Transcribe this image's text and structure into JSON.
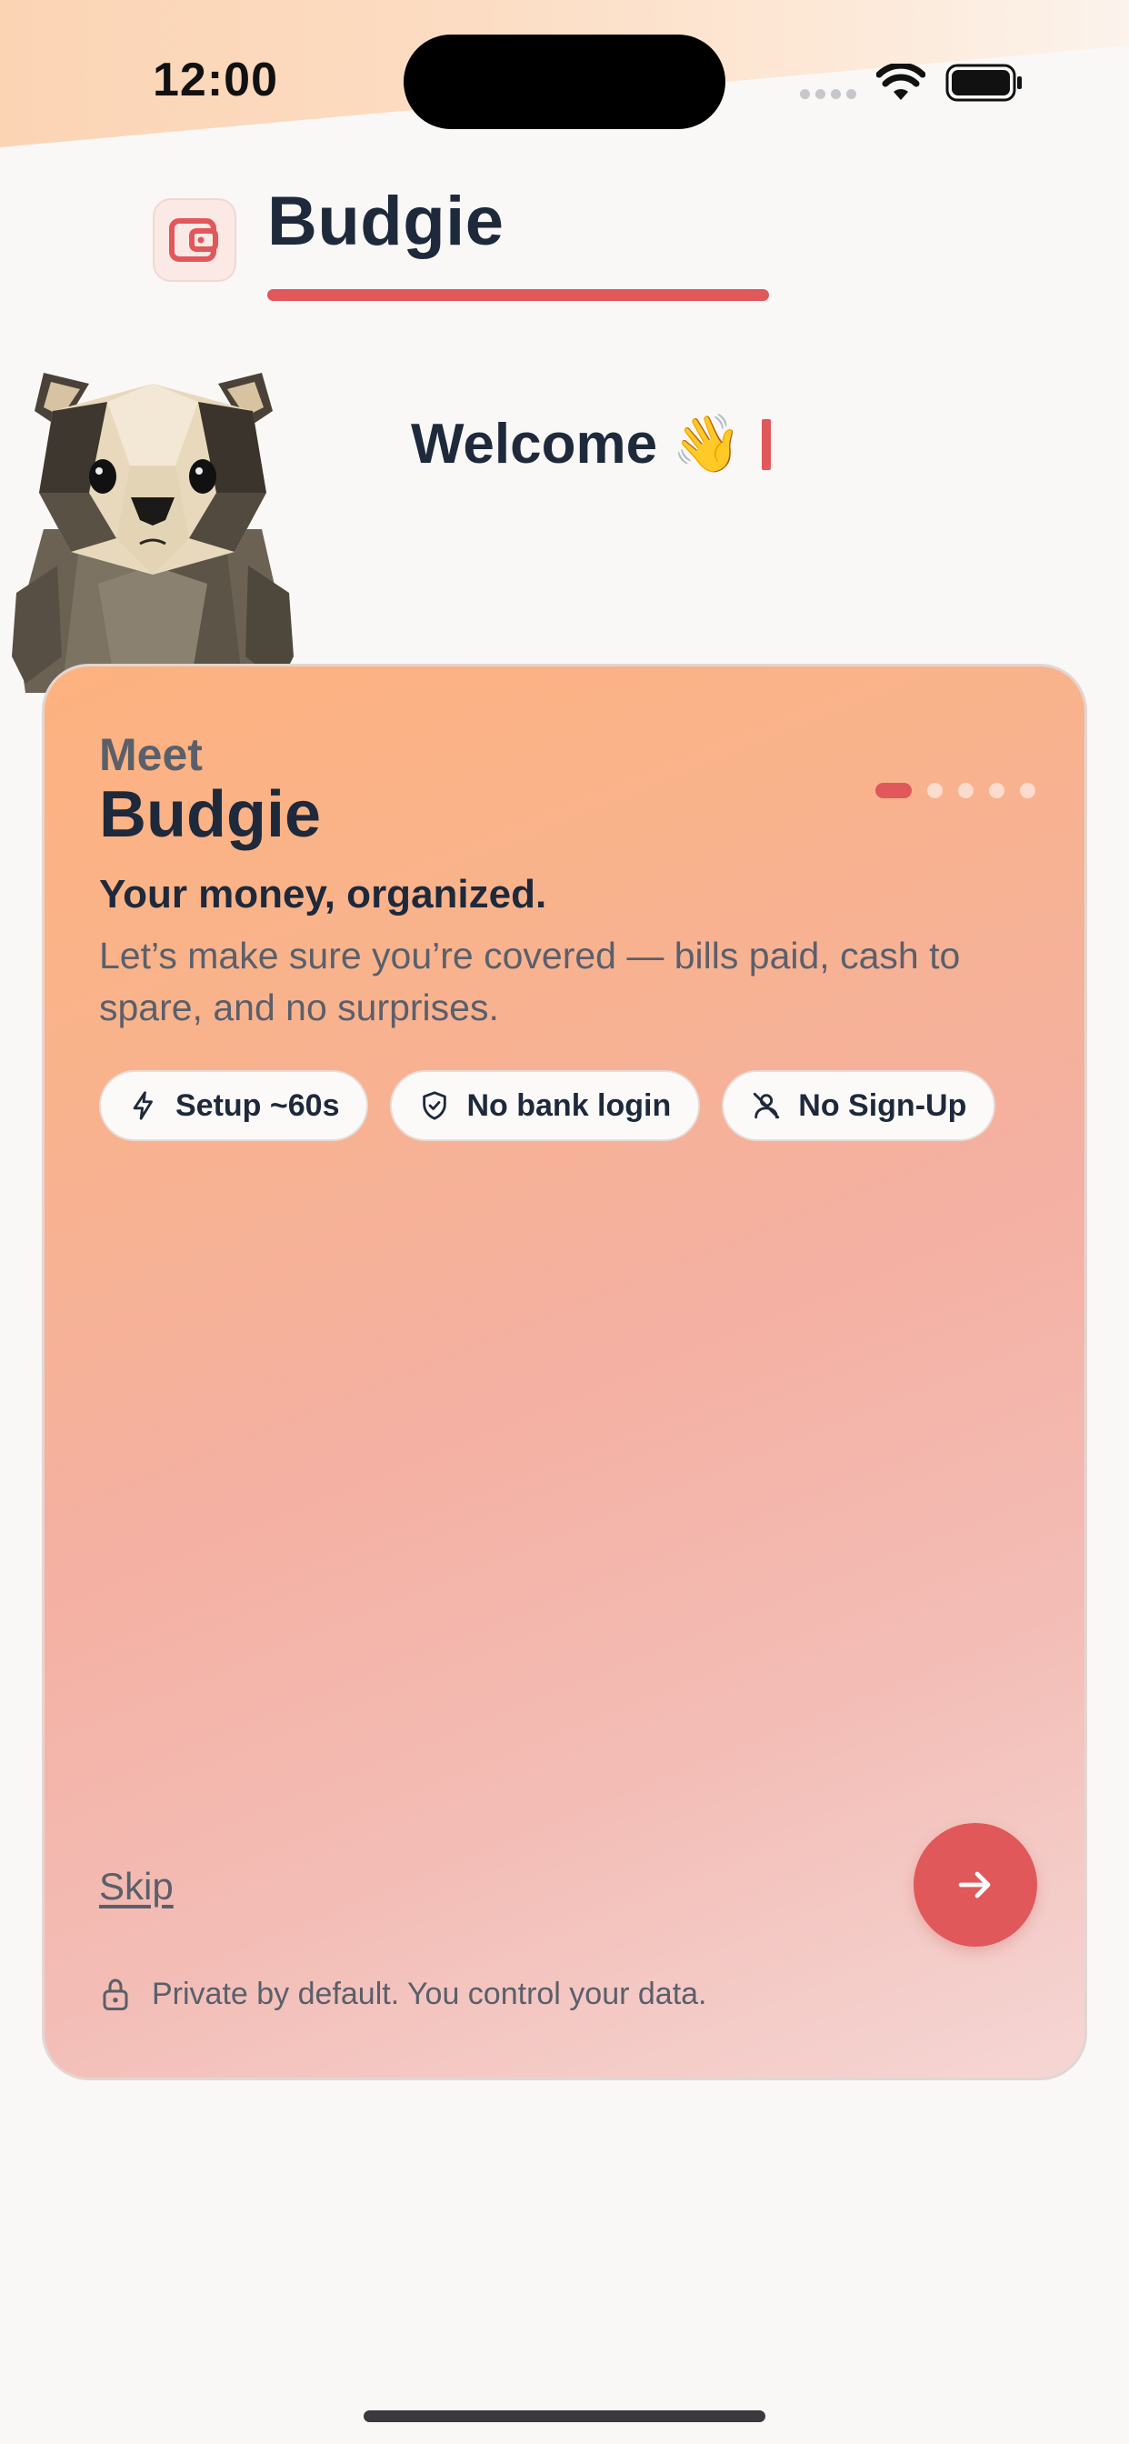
{
  "status_bar": {
    "time": "12:00"
  },
  "header": {
    "app_name": "Budgie",
    "logo_icon": "wallet-icon"
  },
  "welcome": {
    "text": "Welcome",
    "emoji": "👋"
  },
  "card": {
    "eyebrow": "Meet",
    "title": "Budgie",
    "tagline": "Your money, organized.",
    "description": "Let’s make sure you’re covered — bills paid, cash to spare, and no surprises.",
    "pager": {
      "total": 5,
      "current": 1
    },
    "chips": [
      {
        "icon": "bolt-icon",
        "label": "Setup ~60s"
      },
      {
        "icon": "shield-check-icon",
        "label": "No bank login"
      },
      {
        "icon": "user-off-icon",
        "label": "No Sign-Up"
      }
    ],
    "skip_label": "Skip",
    "next_icon": "arrow-right-icon",
    "privacy_text": "Private by default. You control your data.",
    "privacy_icon": "lock-icon"
  },
  "colors": {
    "accent": "#e0585a",
    "text_dark": "#1e293b",
    "text_muted": "#5a5f6b",
    "card_gradient_start": "#fdb27f",
    "card_gradient_end": "#f5d6d4",
    "background": "#f9f8f6"
  }
}
